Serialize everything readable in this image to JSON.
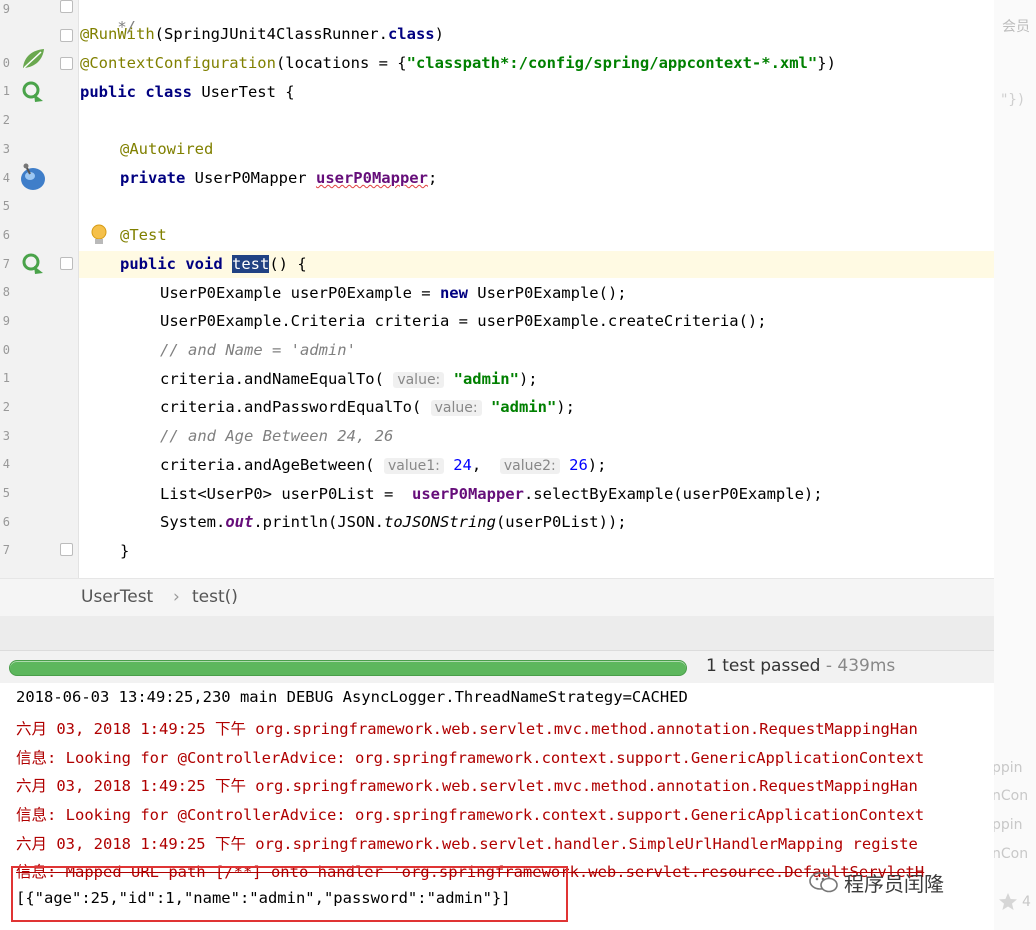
{
  "gutter": {
    "line_numbers": [
      "9",
      "0",
      "1",
      "2",
      "3",
      "4",
      "5",
      "6",
      "7",
      "8",
      "9",
      "0",
      "1",
      "2",
      "3",
      "4",
      "5",
      "6",
      "7"
    ]
  },
  "code": {
    "l0": "*/",
    "l1_ann": "@RunWith",
    "l1_rest": "(SpringJUnit4ClassRunner.",
    "l1_kw": "class",
    "l1_end": ")",
    "l2_ann": "@ContextConfiguration",
    "l2_rest": "(locations = {",
    "l2_str": "\"classpath*:/config/spring/appcontext-*.xml\"",
    "l2_end": "})",
    "l3_kw": "public class",
    "l3_rest": " UserTest {",
    "l5_ann": "@Autowired",
    "l6_kw": "private",
    "l6_rest": " UserP0Mapper ",
    "l6_field": "userP0Mapper",
    "l6_end": ";",
    "l8_ann": "@Test",
    "l9_kw": "public void",
    "l9_sel": "test",
    "l9_rest": "() {",
    "l10_a": "UserP0Example userP0Example = ",
    "l10_kw": "new",
    "l10_b": " UserP0Example();",
    "l11": "UserP0Example.Criteria criteria = userP0Example.createCriteria();",
    "l12": "// and Name = 'admin'",
    "l13_a": "criteria.andNameEqualTo(",
    "l13_hint": "value:",
    "l13_str": "\"admin\"",
    "l13_end": ");",
    "l14_a": "criteria.andPasswordEqualTo(",
    "l14_hint": "value:",
    "l14_str": "\"admin\"",
    "l14_end": ");",
    "l15": "// and Age Between 24, 26",
    "l16_a": "criteria.andAgeBetween(",
    "l16_hint1": "value1:",
    "l16_num1": "24",
    "l16_comma": ",",
    "l16_hint2": "value2:",
    "l16_num2": "26",
    "l16_end": ");",
    "l17_a": "List<UserP0> userP0List = ",
    "l17_field": "userP0Mapper",
    "l17_b": ".selectByExample(userP0Example);",
    "l18_a": "System.",
    "l18_field": "out",
    "l18_b": ".println(JSON.",
    "l18_static": "toJSONString",
    "l18_c": "(userP0List));",
    "l19": "}"
  },
  "breadcrumb": {
    "class_name": "UserTest",
    "separator": "›",
    "method_name": "test()"
  },
  "test_run": {
    "status": "1 test passed",
    "time": " - 439ms",
    "progress": 1.0
  },
  "console": {
    "lines": [
      "2018-06-03 13:49:25,230 main DEBUG AsyncLogger.ThreadNameStrategy=CACHED",
      "六月 03, 2018 1:49:25 下午 org.springframework.web.servlet.mvc.method.annotation.RequestMappingHan",
      "信息: Looking for @ControllerAdvice: org.springframework.context.support.GenericApplicationContext",
      "六月 03, 2018 1:49:25 下午 org.springframework.web.servlet.mvc.method.annotation.RequestMappingHan",
      "信息: Looking for @ControllerAdvice: org.springframework.context.support.GenericApplicationContext",
      "六月 03, 2018 1:49:25 下午 org.springframework.web.servlet.handler.SimpleUrlHandlerMapping registe",
      "信息: Mapped URL path [/**] onto handler 'org.springframework.web.servlet.resource.DefaultServletH",
      "[{\"age\":25,\"id\":1,\"name\":\"admin\",\"password\":\"admin\"}]"
    ]
  },
  "right_panel": {
    "top_label": "会员",
    "snippet": "\"})",
    "frag1": "ppin",
    "frag2": "nCon",
    "frag3": "ppin",
    "frag4": "nCon",
    "star_count": "4"
  },
  "watermark": "程序员闰隆"
}
